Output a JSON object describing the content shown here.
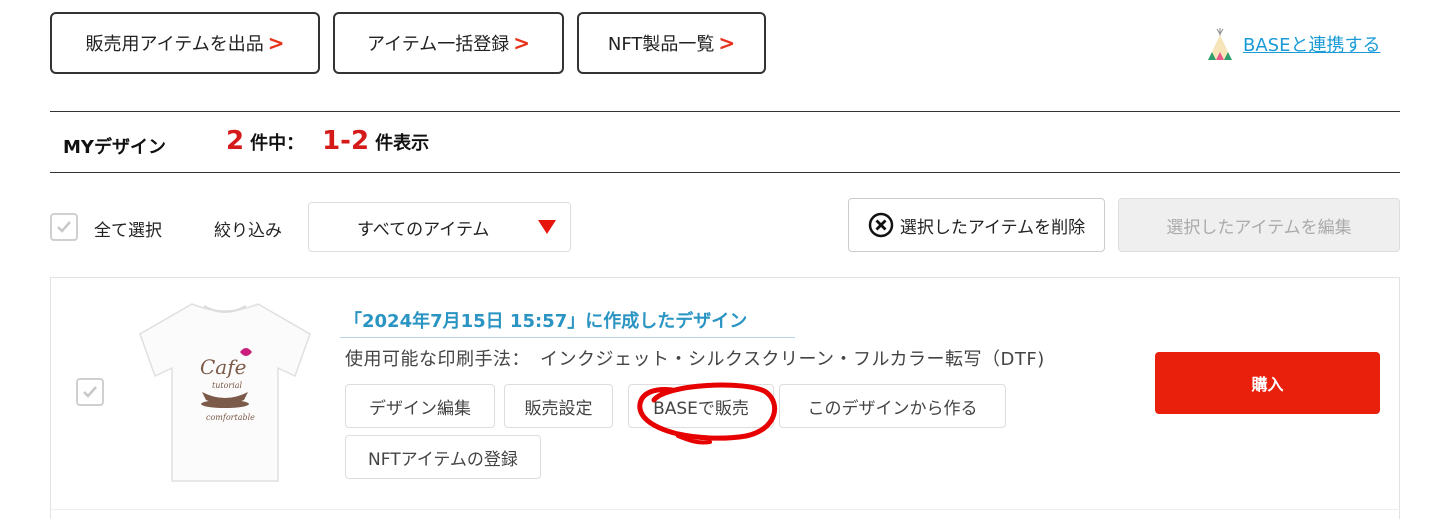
{
  "toolbar": {
    "sell_label": "販売用アイテムを出品",
    "bulk_label": "アイテム一括登録",
    "nft_label": "NFT製品一覧",
    "chevron": ">"
  },
  "base_link": {
    "label": "BASEと連携する",
    "icon": "teepee-icon"
  },
  "summary": {
    "title": "MYデザイン",
    "total": "2",
    "total_suffix": "件中：",
    "range": "1-2",
    "range_suffix": "件表示"
  },
  "filters": {
    "select_all_label": "全て選択",
    "filter_label": "絞り込み",
    "filter_value": "すべてのアイテム",
    "delete_label": "選択したアイテムを削除",
    "edit_selected_label": "選択したアイテムを編集"
  },
  "item": {
    "title": "「2024年7月15日 15:57」に作成したデザイン",
    "methods_label": "使用可能な印刷手法：",
    "methods_value": "インクジェット・シルクスクリーン・フルカラー転写（DTF)",
    "actions": {
      "edit": "デザイン編集",
      "sale_settings": "販売設定",
      "sell_on_base": "BASEで販売",
      "create_from": "このデザインから作る",
      "nft_register": "NFTアイテムの登録"
    },
    "buy_label": "購入",
    "thumbnail": {
      "text_main": "Cafe",
      "text_sub1": "tutorial",
      "text_sub2": "comfortable"
    }
  },
  "colors": {
    "accent_red": "#e8200c",
    "link_blue": "#1a9bd7",
    "title_blue": "#2a94c3",
    "count_red": "#d51a1a"
  }
}
